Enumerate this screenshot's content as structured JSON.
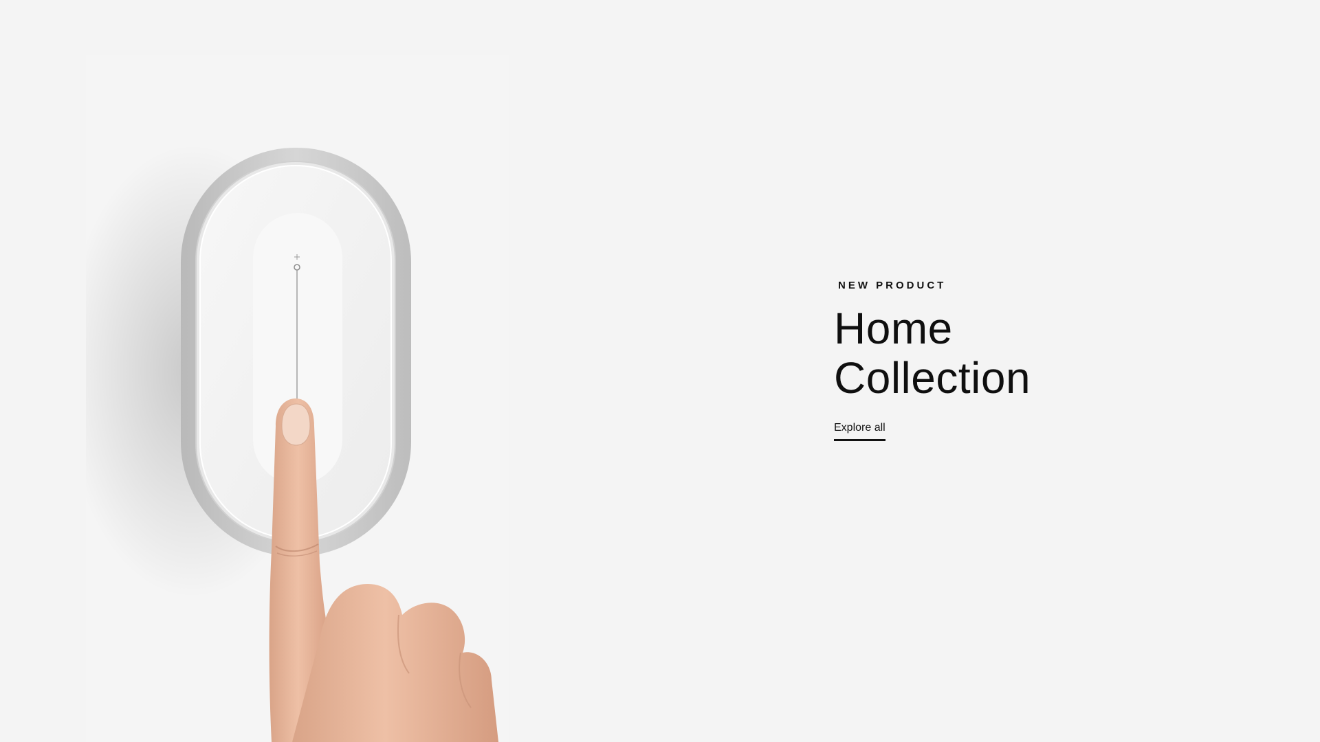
{
  "hero": {
    "eyebrow": "NEW PRODUCT",
    "title_line1": "Home",
    "title_line2": "Collection",
    "cta_label": "Explore all"
  },
  "colors": {
    "background": "#f4f4f4",
    "text": "#111111"
  },
  "icons": {
    "hero_image": "hand-pressing-switch-image"
  }
}
